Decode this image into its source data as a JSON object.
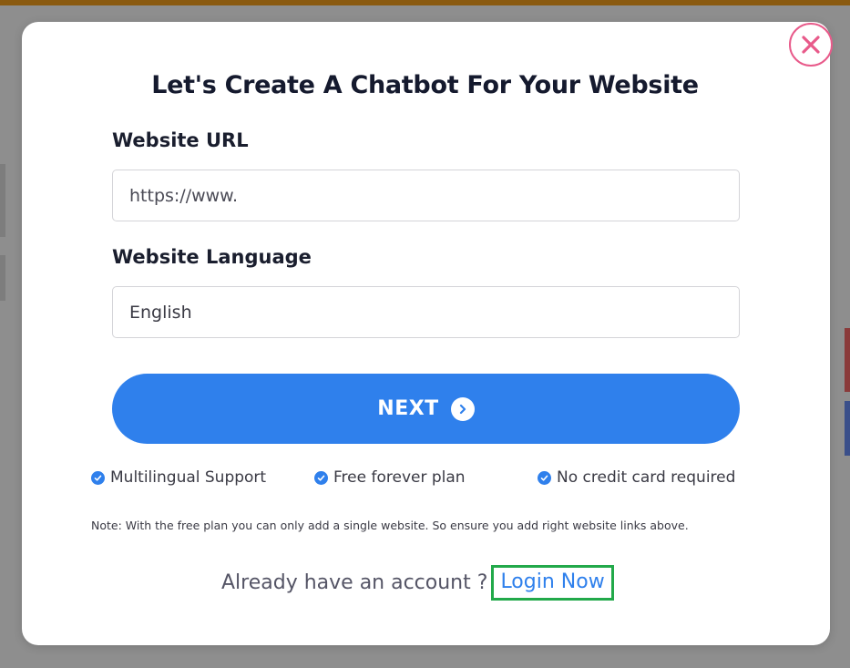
{
  "modal": {
    "title": "Let's Create A Chatbot For Your Website",
    "close_icon": "close-icon",
    "url_field": {
      "label": "Website URL",
      "placeholder": "https://www."
    },
    "language_field": {
      "label": "Website Language",
      "value": "English"
    },
    "next_button": {
      "label": "NEXT",
      "icon": "chevron-right-circle-icon"
    },
    "features": [
      {
        "label": "Multilingual Support",
        "icon": "check-circle-icon"
      },
      {
        "label": "Free forever plan",
        "icon": "check-circle-icon"
      },
      {
        "label": "No credit card required",
        "icon": "check-circle-icon"
      }
    ],
    "note": "Note: With the free plan you can only add a single website. So ensure you add right website links above.",
    "login_prompt": "Already have an account ?",
    "login_link": "Login Now"
  },
  "colors": {
    "accent": "#2f80ec",
    "close_border": "#e85a8a",
    "highlight_border": "#22a94a",
    "title": "#151a2e"
  }
}
